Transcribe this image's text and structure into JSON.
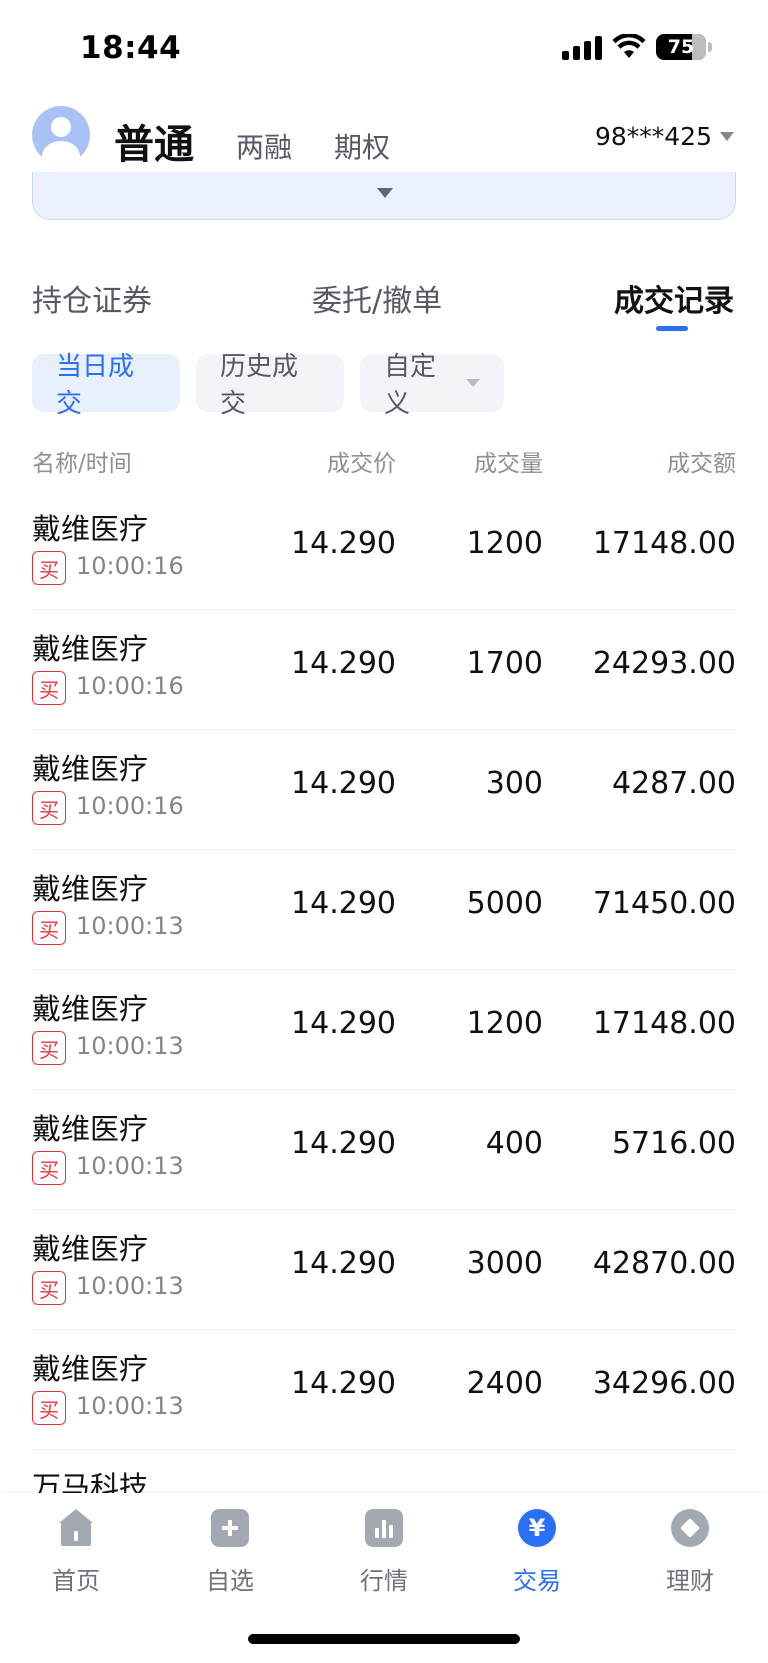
{
  "status_bar": {
    "time": "18:44",
    "battery": "75",
    "icons": [
      "signal-icon",
      "wifi-icon",
      "battery-icon"
    ]
  },
  "header": {
    "account_type_selected": "普通",
    "account_types": [
      "两融",
      "期权"
    ],
    "account_number": "98***425"
  },
  "main_tabs": {
    "items": [
      "持仓证券",
      "委托/撤单",
      "成交记录"
    ],
    "active": "成交记录"
  },
  "filters": {
    "today": "当日成交",
    "history": "历史成交",
    "custom": "自定义",
    "active": "当日成交"
  },
  "table": {
    "headers": {
      "name_time": "名称/时间",
      "price": "成交价",
      "quantity": "成交量",
      "amount": "成交额"
    },
    "rows": [
      {
        "name": "戴维医疗",
        "side": "买",
        "time": "10:00:16",
        "price": "14.290",
        "quantity": "1200",
        "amount": "17148.00"
      },
      {
        "name": "戴维医疗",
        "side": "买",
        "time": "10:00:16",
        "price": "14.290",
        "quantity": "1700",
        "amount": "24293.00"
      },
      {
        "name": "戴维医疗",
        "side": "买",
        "time": "10:00:16",
        "price": "14.290",
        "quantity": "300",
        "amount": "4287.00"
      },
      {
        "name": "戴维医疗",
        "side": "买",
        "time": "10:00:13",
        "price": "14.290",
        "quantity": "5000",
        "amount": "71450.00"
      },
      {
        "name": "戴维医疗",
        "side": "买",
        "time": "10:00:13",
        "price": "14.290",
        "quantity": "1200",
        "amount": "17148.00"
      },
      {
        "name": "戴维医疗",
        "side": "买",
        "time": "10:00:13",
        "price": "14.290",
        "quantity": "400",
        "amount": "5716.00"
      },
      {
        "name": "戴维医疗",
        "side": "买",
        "time": "10:00:13",
        "price": "14.290",
        "quantity": "3000",
        "amount": "42870.00"
      },
      {
        "name": "戴维医疗",
        "side": "买",
        "time": "10:00:13",
        "price": "14.290",
        "quantity": "2400",
        "amount": "34296.00"
      }
    ],
    "partial_row_name": "万马科技"
  },
  "bottom_nav": {
    "items": [
      {
        "label": "首页",
        "icon": "home-icon"
      },
      {
        "label": "自选",
        "icon": "plus-icon"
      },
      {
        "label": "行情",
        "icon": "chart-icon"
      },
      {
        "label": "交易",
        "icon": "yen-icon"
      },
      {
        "label": "理财",
        "icon": "diamond-icon"
      }
    ],
    "active": "交易"
  },
  "colors": {
    "accent": "#2b6ff5",
    "buy": "#e5333b",
    "muted": "#808590"
  }
}
